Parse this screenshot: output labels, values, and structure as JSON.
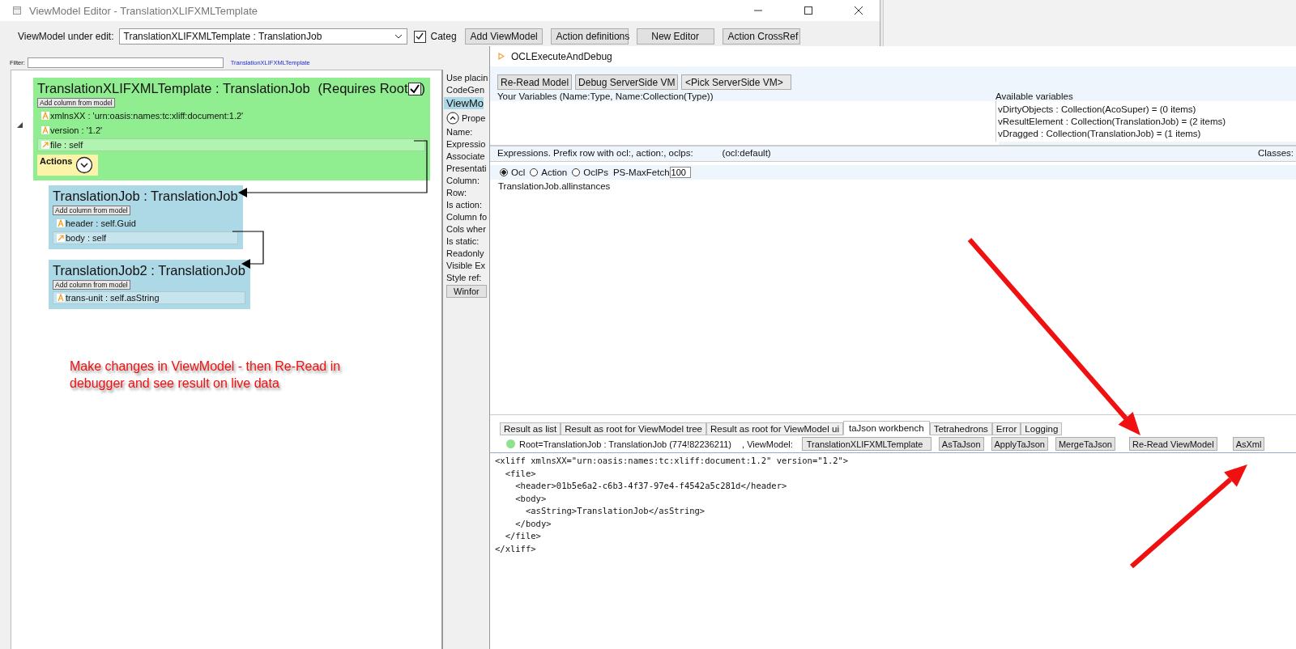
{
  "editor_window": {
    "title": "ViewModel Editor - TranslationXLIFXMLTemplate",
    "viewmodel_label": "ViewModel under edit:",
    "viewmodel_value": "TranslationXLIFXMLTemplate : TranslationJob",
    "categ": {
      "label": "Categ",
      "checked": true
    },
    "buttons": [
      "Add ViewModel",
      "Action definitions",
      "New Editor",
      "Action CrossRef"
    ],
    "filter": {
      "label": "Filter:",
      "link": "TranslationXLIFXMLTemplate"
    },
    "nodes": [
      {
        "title": "TranslationXLIFXMLTemplate : TranslationJob",
        "color": "#90ee90",
        "requires_root": {
          "label": "(Requires Root",
          "checked": true,
          "close": ")"
        },
        "add_button": "Add column from model",
        "columns": [
          {
            "kind": "attribute",
            "text": "xmlnsXX : 'urn:oasis:names:tc:xliff:document:1.2'",
            "highlighted": false
          },
          {
            "kind": "attribute",
            "text": "version : '1.2'",
            "highlighted": false
          },
          {
            "kind": "reference",
            "text": "file : self",
            "highlighted": true
          }
        ],
        "actions": "Actions"
      },
      {
        "title": "TranslationJob : TranslationJob",
        "color": "#add8e6",
        "add_button": "Add column from model",
        "columns": [
          {
            "kind": "attribute",
            "text": "header : self.Guid",
            "highlighted": false
          },
          {
            "kind": "reference",
            "text": "body : self",
            "highlighted": true
          }
        ]
      },
      {
        "title": "TranslationJob2 : TranslationJob",
        "color": "#add8e6",
        "add_button": "Add column from model",
        "columns": [
          {
            "kind": "attribute",
            "text": "trans-unit : self.asString",
            "highlighted": true
          }
        ]
      }
    ],
    "properties": {
      "options": [
        "Use placin",
        "CodeGen"
      ],
      "header": "ViewMo",
      "section": "Prope",
      "fields": [
        "Name:",
        "Expressio",
        "Associate",
        "Presentati",
        "Column:",
        "Row:",
        "Is action:",
        "Column fo",
        "Cols wher",
        "Is static:",
        "Readonly",
        "Visible Ex",
        "Style ref:"
      ],
      "button": "Winfor"
    },
    "note": "Make changes in ViewModel - then Re-Read in debugger and see result on live data"
  },
  "debug_window": {
    "title": "OCLExecuteAndDebug",
    "buttons": [
      "Re-Read Model",
      "Debug ServerSide VM"
    ],
    "vm_picker": "<Pick ServerSide VM>",
    "variables_label": "Your Variables (Name:Type, Name:Collection(Type))",
    "available_label": "Available variables",
    "available_variables": [
      "vDirtyObjects : Collection(AcoSuper) = (0 items)",
      "vResultElement : Collection(TranslationJob) = (2 items)",
      "vDragged : Collection(TranslationJob) = (1 items)"
    ],
    "expressions_label": "Expressions. Prefix row with ocl:, action:, oclps:",
    "expressions_default": "(ocl:default)",
    "classes_label": "Classes:",
    "modes": [
      {
        "label": "Ocl",
        "selected": true
      },
      {
        "label": "Action",
        "selected": false
      },
      {
        "label": "OclPs",
        "selected": false
      }
    ],
    "max_fetch_label": "PS-MaxFetch",
    "max_fetch_value": "100",
    "expression": "TranslationJob.allinstances",
    "tabs": [
      {
        "label": "Result as list",
        "selected": false
      },
      {
        "label": "Result as root for ViewModel tree",
        "selected": false
      },
      {
        "label": "Result as root for ViewModel ui",
        "selected": false
      },
      {
        "label": "taJson workbench",
        "selected": true
      },
      {
        "label": "Tetrahedrons",
        "selected": false
      },
      {
        "label": "Error",
        "selected": false
      },
      {
        "label": "Logging",
        "selected": false
      }
    ],
    "root_label": "Root=TranslationJob : TranslationJob  (774!82236211)",
    "viewmodel_label": ", ViewModel:",
    "viewmodel_value": "TranslationXLIFXMLTemplate",
    "actions": [
      "AsTaJson",
      "ApplyTaJson",
      "MergeTaJson",
      "Re-Read ViewModel",
      "AsXml"
    ],
    "output": [
      "<xliff xmlnsXX=\"urn:oasis:names:tc:xliff:document:1.2\" version=\"1.2\">",
      "  <file>",
      "    <header>01b5e6a2-c6b3-4f37-97e4-f4542a5c281d</header>",
      "    <body>",
      "      <asString>TranslationJob</asString>",
      "    </body>",
      "  </file>",
      "</xliff>"
    ]
  }
}
